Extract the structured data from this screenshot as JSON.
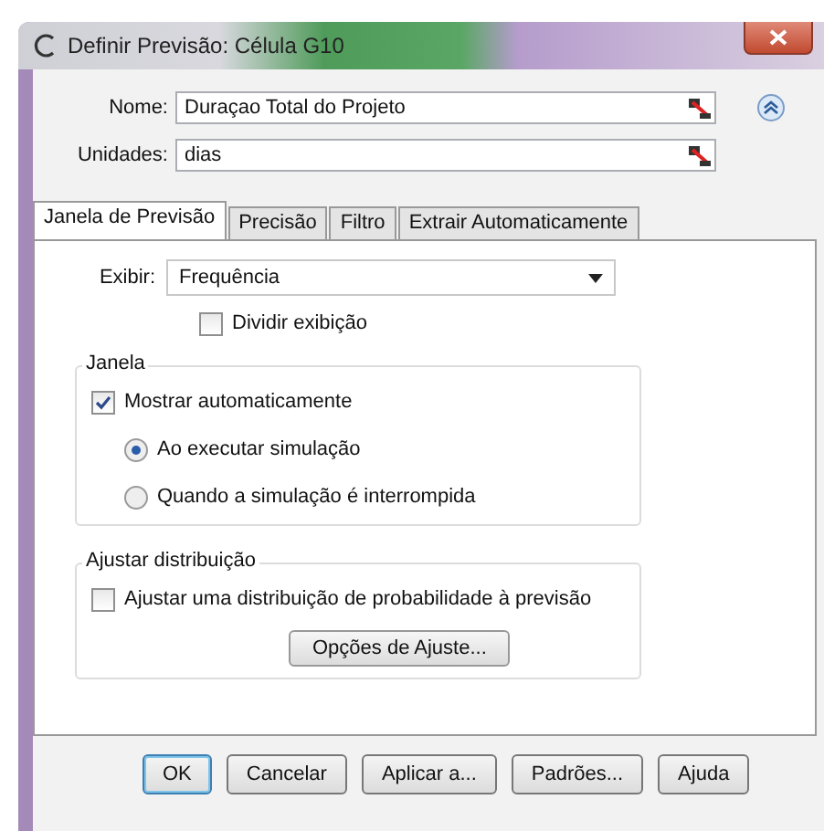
{
  "window": {
    "title": "Definir Previsão: Célula G10"
  },
  "fields": [
    {
      "label": "Nome:",
      "value": "Duraçao Total do Projeto"
    },
    {
      "label": "Unidades:",
      "value": "dias"
    }
  ],
  "tabs": [
    {
      "label": "Janela de Previsão",
      "selected": true
    },
    {
      "label": "Precisão",
      "selected": false
    },
    {
      "label": "Filtro",
      "selected": false
    },
    {
      "label": "Extrair Automaticamente",
      "selected": false
    }
  ],
  "display": {
    "label": "Exibir:",
    "value": "Frequência"
  },
  "split_display": {
    "label": "Dividir exibição",
    "checked": false
  },
  "window_group": {
    "title": "Janela",
    "auto_show": {
      "label": "Mostrar automaticamente",
      "checked": true
    },
    "options": [
      {
        "label": "Ao executar simulação",
        "selected": true
      },
      {
        "label": "Quando a simulação é interrompida",
        "selected": false
      }
    ]
  },
  "fit_group": {
    "title": "Ajustar distribuição",
    "fit": {
      "label": "Ajustar uma distribuição de probabilidade à previsão",
      "checked": false
    },
    "button": "Opções de Ajuste..."
  },
  "buttons": [
    {
      "label": "OK",
      "default": true
    },
    {
      "label": "Cancelar",
      "default": false
    },
    {
      "label": "Aplicar a...",
      "default": false
    },
    {
      "label": "Padrões...",
      "default": false
    },
    {
      "label": "Ajuda",
      "default": false
    }
  ]
}
